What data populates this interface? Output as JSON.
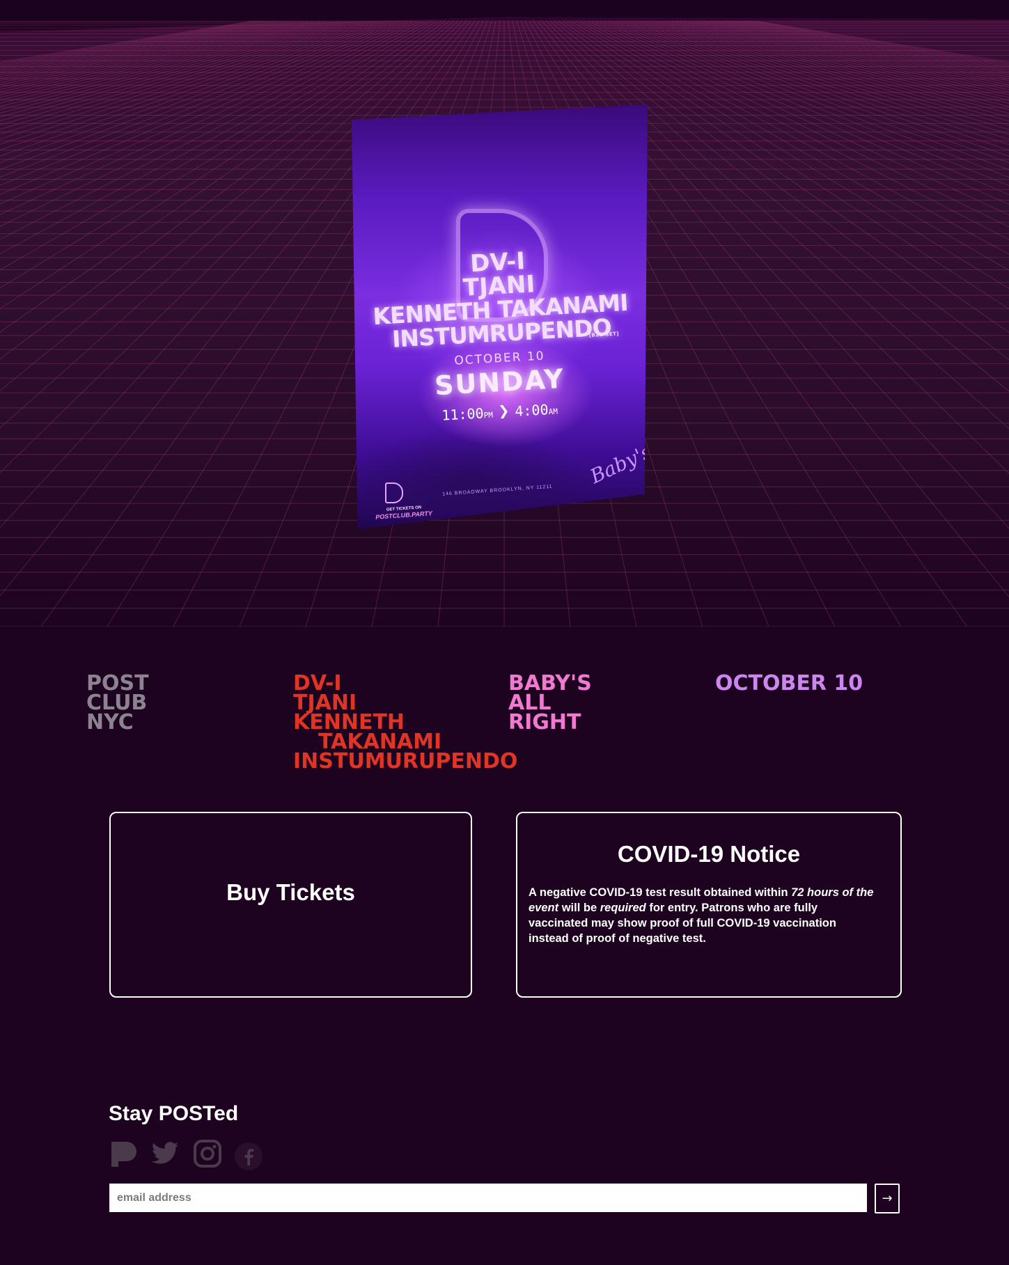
{
  "poster": {
    "lineup": [
      "DV-I",
      "TJANI",
      "KENNETH TAKANAMI",
      "INSTUMRUPENDO"
    ],
    "b2b_note": "[B2B SET]",
    "date": "OCTOBER 10",
    "day": "SUNDAY",
    "start_time": "11:00",
    "start_suffix": "PM",
    "arrow": "❯",
    "end_time": "4:00",
    "end_suffix": "AM",
    "get_tickets": "GET TICKETS ON",
    "site": "POSTCLUB.PARTY",
    "address": "146 BROADWAY BROOKLYN, NY 11211",
    "venue_script": "Baby's"
  },
  "info": {
    "brand": [
      "POST",
      "CLUB",
      "NYC"
    ],
    "artists": [
      "DV-I",
      "TJANI",
      "KENNETH",
      "TAKANAMI",
      "INSTUMURUPENDO"
    ],
    "venue": [
      "BABY'S",
      "ALL",
      "RIGHT"
    ],
    "date": "OCTOBER 10"
  },
  "tickets": {
    "label": "Buy Tickets"
  },
  "covid": {
    "title": "COVID-19 Notice",
    "text_1": "A negative COVID-19 test result obtained within ",
    "em_1": "72 hours of the event",
    "text_2": " will be ",
    "em_2": "required",
    "text_3": " for entry. Patrons who are fully vaccinated may show proof of full COVID-19 vaccination instead of proof of negative test."
  },
  "footer": {
    "title": "Stay POSTed",
    "email_placeholder": "email address",
    "submit_label": "→",
    "social_icons": [
      "postclub-icon",
      "twitter-icon",
      "instagram-icon",
      "facebook-icon"
    ]
  },
  "colors": {
    "background": "#1e0320",
    "brand_grey": "#8b8490",
    "artists_red": "#e03524",
    "venue_pink": "#f279d2",
    "date_lilac": "#cc86f0"
  }
}
